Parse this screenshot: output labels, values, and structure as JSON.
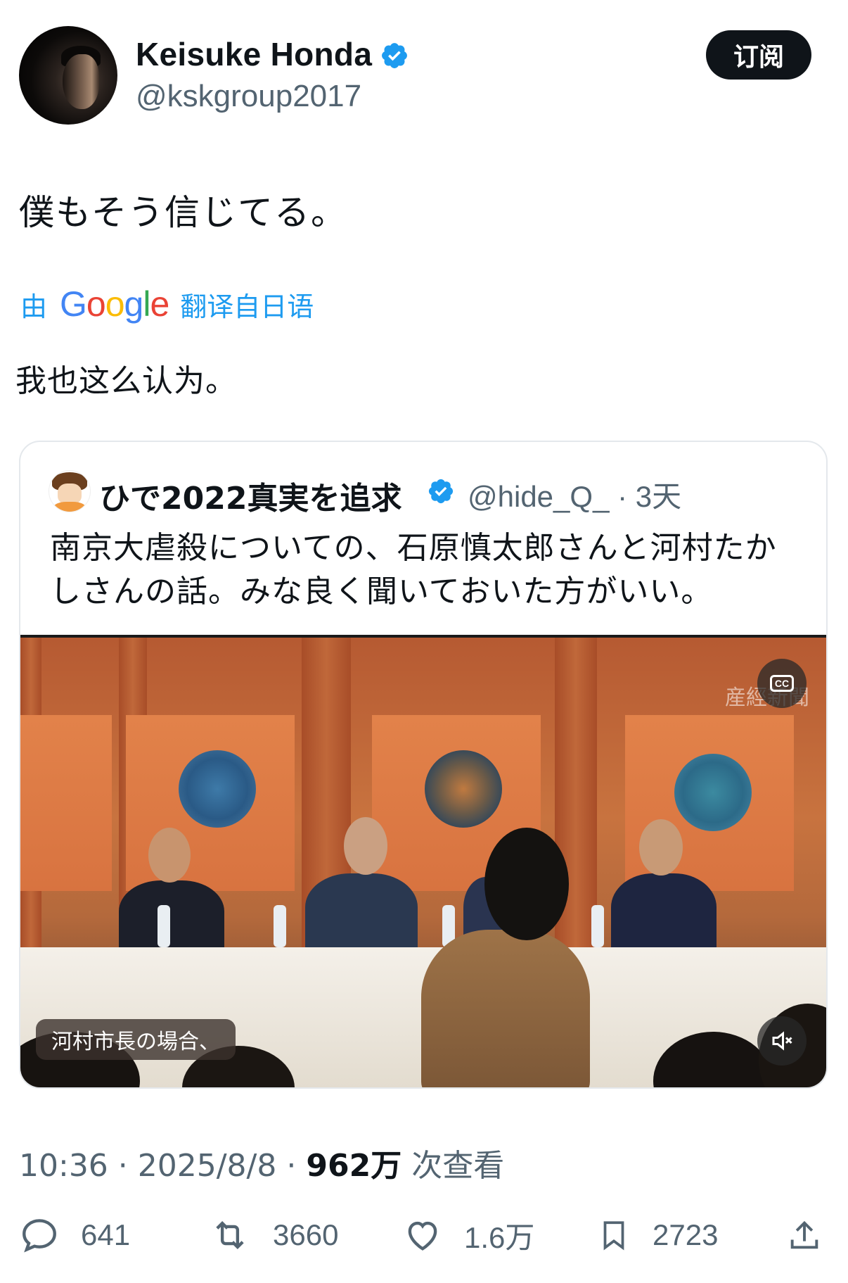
{
  "author": {
    "name": "Keisuke Honda",
    "handle": "@kskgroup2017",
    "verified": true,
    "subscribe_label": "订阅"
  },
  "tweet": {
    "text": "僕もそう信じてる。",
    "translate_prefix": "由",
    "translate_brand": "Google",
    "translate_suffix": "翻译自日语",
    "translation": "我也这么认为。"
  },
  "quote": {
    "name": "ひで2022真実を追求",
    "handle_time": "@hide_Q_ · 3天",
    "verified": true,
    "text": "南京大虐殺についての、石原慎太郎さんと河村たかしさんの話。みな良く聞いておいた方がいい。",
    "media": {
      "watermark": "産經新聞",
      "subtitle": "河村市長の場合、",
      "cc_icon": "cc-icon",
      "mute_icon": "mute-icon"
    }
  },
  "meta": {
    "time_date": "10:36 · 2025/8/8 · ",
    "views_count": "962万",
    "views_label": " 次查看"
  },
  "actions": {
    "replies": "641",
    "retweets": "3660",
    "likes": "1.6万",
    "bookmarks": "2723"
  },
  "colors": {
    "accent": "#1d9bf0",
    "text": "#0f1419",
    "secondary": "#536471"
  }
}
